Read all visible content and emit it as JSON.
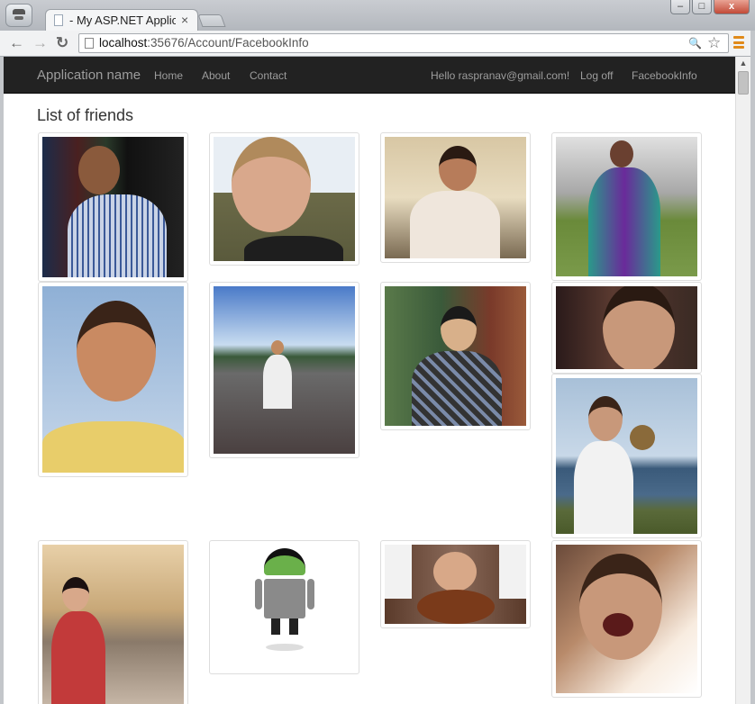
{
  "browser": {
    "tab_title": "- My ASP.NET Applic",
    "tab_close": "×",
    "url_host": "localhost",
    "url_rest": ":35676/Account/FacebookInfo",
    "back_glyph": "←",
    "forward_glyph": "→",
    "reload_glyph": "↻",
    "search_glyph": "🔍",
    "star_glyph": "☆",
    "minimize_glyph": "–",
    "maximize_glyph": "□",
    "close_glyph": "x"
  },
  "navbar": {
    "brand": "Application name",
    "links": [
      "Home",
      "About",
      "Contact"
    ],
    "greeting": "Hello raspranav@gmail.com!",
    "logoff": "Log off",
    "facebook_info": "FacebookInfo"
  },
  "page": {
    "heading": "List of friends"
  },
  "friends": [
    {
      "photo": "friend-photo-man-glasses-bookshelf"
    },
    {
      "photo": "friend-photo-blond-man-outdoors"
    },
    {
      "photo": "friend-photo-bride-veil"
    },
    {
      "photo": "friend-photo-woman-traditional-dress"
    },
    {
      "photo": "friend-photo-smiling-man-palm"
    },
    {
      "photo": "friend-photo-man-by-water"
    },
    {
      "photo": "friend-photo-man-peace-sign"
    },
    {
      "photo": "friend-photo-man-glasses-closeup"
    },
    {
      "photo": "friend-photo-man-drinking-coconut"
    },
    {
      "photo": "friend-photo-woman-red-jacket"
    },
    {
      "photo": "friend-photo-android-avatar"
    },
    {
      "photo": "friend-photo-baby-football"
    },
    {
      "photo": "friend-photo-man-glasses-shouting"
    }
  ],
  "colors": {
    "navbar_bg": "#222222",
    "navbar_text": "#9d9d9d",
    "menu_accent": "#e08a1a"
  }
}
